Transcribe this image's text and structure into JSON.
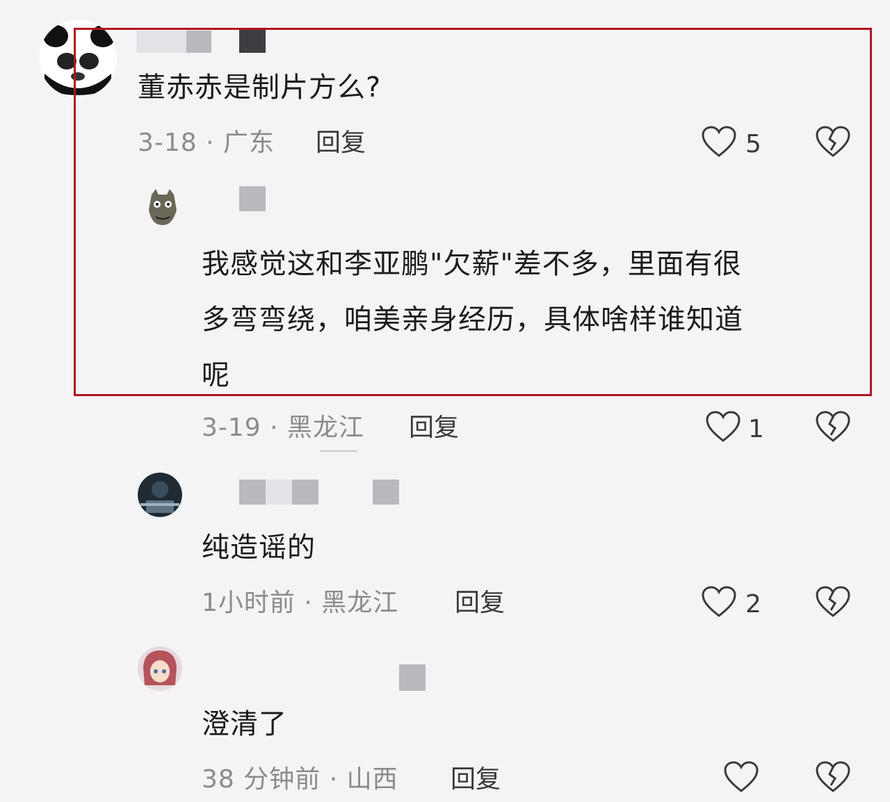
{
  "comments": [
    {
      "text": "董赤赤是制片方么?",
      "date_location": "3-18 · 广东",
      "reply_label": "回复",
      "likes": "5"
    },
    {
      "text_lines": [
        "我感觉这和李亚鹏\"欠薪\"差不多，里面有很",
        "多弯弯绕，咱美亲身经历，具体啥样谁知道",
        "呢"
      ],
      "date_location": "3-19 · 黑龙江",
      "reply_label": "回复",
      "likes": "1"
    },
    {
      "text": "纯造谣的",
      "date_location": "1小时前 · 黑龙江",
      "reply_label": "回复",
      "likes": "2"
    },
    {
      "text": "澄清了",
      "date_location": "38 分钟前 · 山西",
      "reply_label": "回复",
      "likes": ""
    }
  ],
  "icons": {
    "like": "heart-outline-icon",
    "dislike": "broken-heart-icon"
  },
  "colors": {
    "highlight_border": "#b4141e",
    "background": "#f4f4f6",
    "meta_text": "#8a8a8f"
  }
}
